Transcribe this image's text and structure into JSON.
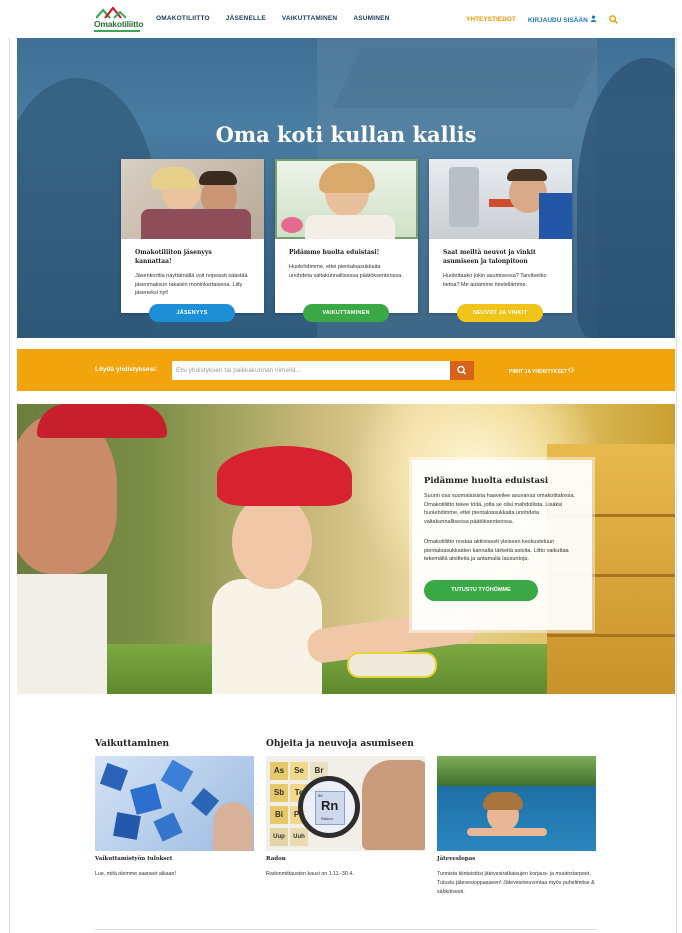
{
  "brand": {
    "logo_text": "Omakotiliitto"
  },
  "nav": {
    "items": [
      "OMAKOTILIITTO",
      "JÄSENELLE",
      "VAIKUTTAMINEN",
      "ASUMINEN"
    ],
    "contacts": "YHTEYSTIEDOT",
    "login": "KIRJAUDU SISÄÄN"
  },
  "hero": {
    "title": "Oma koti kullan kallis",
    "cards": [
      {
        "title": "Omakotiliiton jäsenyys kannattaa!",
        "text": "Jäsenkorttia näyttämällä voit nopeasti säästää jäsenmaksun takaisin moninkertaisena. Liity jäseneksi nyt!",
        "button": "JÄSENYYS",
        "color": "#1d8fd6"
      },
      {
        "title": "Pidämme huolta eduistasi!",
        "text": "Huolehdimme, ettei pientaloasukkaita unohdeta valtakunnallisessa päätöksenteossa.",
        "button": "VAIKUTTAMINEN",
        "color": "#3aa845"
      },
      {
        "title": "Saat meiltä neuvot ja vinkit asumiseen ja talonpitoon",
        "text": "Huolettaako jokin asumisessa? Tarvitsetko tietoa? Me autamme mielellämme.",
        "button": "NEUVOT JA VINKIT",
        "color": "#f0c419"
      }
    ]
  },
  "search": {
    "label": "Löydä yhdistyksesi:",
    "placeholder": "Etsi yhdistyksen tai paikkakunnan nimellä...",
    "link": "PIIRIT JA YHDISTYKSET"
  },
  "feature": {
    "title": "Pidämme huolta eduistasi",
    "paragraph1": "Suurin osa suomalaisista haaveilee asuvansa omakotitalossa. Omakotiliitto tekee töitä, jotta se olisi mahdollista. Lisäksi huolehdimme, ettei pientaloasukkaita unohdeta valtakunnallisessa päätöksenteossa.",
    "paragraph2": "Omakotiliitto nostaa aktiivisesti yleiseen keskusteluun pientaloasukkaiden kannalta tärkeitä asioita. Liitto vaikuttaa tekemällä aloitteita ja antamalla lausuntoja.",
    "button": "TUTUSTU TYÖHÖMME"
  },
  "sections": {
    "left_title": "Vaikuttaminen",
    "right_title": "Ohjeita ja neuvoja asumiseen",
    "tiles": [
      {
        "title": "Vaikuttamistyön tulokset",
        "text": "Lue, mitä olemme saaneet aikaan!"
      },
      {
        "title": "Radon",
        "text": "Radonmittausten kausi on 1.11.-30.4."
      },
      {
        "title": "Jäteveslopas",
        "text": "Tunnista kiinteistösi jätevesiratkaisujen korjaus- ja muutostarpeet. Tutustu jätevesioppaaseen! Jätevesineuvontaa myös puhelimitse & sähköisesti."
      }
    ]
  },
  "periodic": {
    "cells": [
      "As",
      "Se",
      "Br",
      "Sb",
      "Te",
      "I",
      "Bi",
      "Po",
      "Uup",
      "Uuh"
    ],
    "highlight": "Rn",
    "highlight_name": "Radon",
    "highlight_num": "86"
  }
}
